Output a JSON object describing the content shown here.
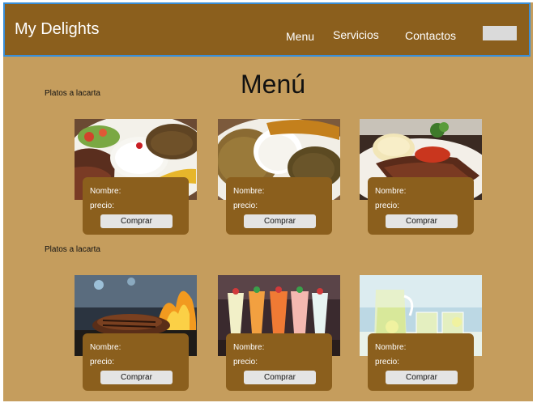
{
  "header": {
    "brand": "My Delights",
    "nav": [
      "Menu",
      "Servicios",
      "Contactos"
    ]
  },
  "page_title": "Menú",
  "sections": [
    {
      "label": "Platos a lacarta",
      "items": [
        {
          "image": "plato-arroz-carne-ensalada",
          "name_label": "Nombre:",
          "price_label": "precio:",
          "button": "Comprar"
        },
        {
          "image": "plato-carne-molida-arroz-platano",
          "name_label": "Nombre:",
          "price_label": "precio:",
          "button": "Comprar"
        },
        {
          "image": "plato-carne-pure",
          "name_label": "Nombre:",
          "price_label": "precio:",
          "button": "Comprar"
        }
      ]
    },
    {
      "label": "Platos a lacarta",
      "items": [
        {
          "image": "carne-a-la-parrilla",
          "name_label": "Nombre:",
          "price_label": "precio:",
          "button": "Comprar"
        },
        {
          "image": "cocteles-coloridos",
          "name_label": "Nombre:",
          "price_label": "precio:",
          "button": "Comprar"
        },
        {
          "image": "limonada-jarra",
          "name_label": "Nombre:",
          "price_label": "precio:",
          "button": "Comprar"
        }
      ]
    }
  ],
  "colors": {
    "background": "#c59d5d",
    "header": "#8b5f1d",
    "header_border": "#3a8fd8",
    "card": "#8b5f1d",
    "button": "#e4e4e4"
  }
}
